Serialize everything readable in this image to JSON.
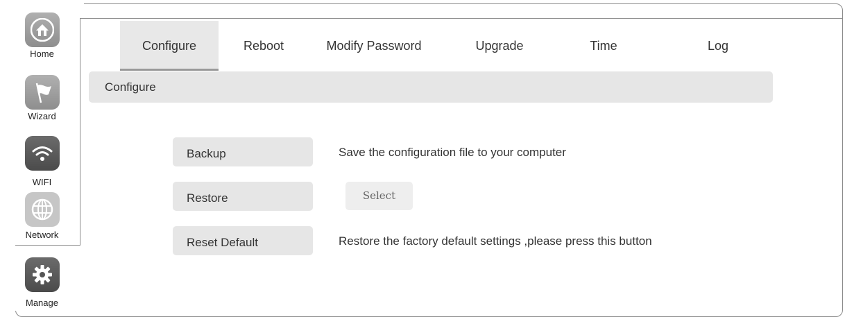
{
  "sidebar": {
    "items": [
      {
        "label": "Home",
        "icon": "home-icon"
      },
      {
        "label": "Wizard",
        "icon": "flag-icon"
      },
      {
        "label": "WIFI",
        "icon": "wifi-icon"
      },
      {
        "label": "Network",
        "icon": "globe-icon"
      },
      {
        "label": "Manage",
        "icon": "gear-icon",
        "active": true
      }
    ]
  },
  "tabs": [
    {
      "label": "Configure",
      "active": true
    },
    {
      "label": "Reboot"
    },
    {
      "label": "Modify Password"
    },
    {
      "label": "Upgrade"
    },
    {
      "label": "Time"
    },
    {
      "label": "Log"
    }
  ],
  "section": {
    "title": "Configure"
  },
  "actions": {
    "backup": {
      "label": "Backup",
      "description": "Save the configuration file to your computer"
    },
    "restore": {
      "label": "Restore",
      "select_label": "Select"
    },
    "reset": {
      "label": "Reset Default",
      "description": "Restore the factory default settings ,please press this button"
    }
  },
  "colors": {
    "icon_gray": "#9e9e9e",
    "icon_active": "#5a5a5a",
    "panel_bg": "#e6e6e6"
  }
}
